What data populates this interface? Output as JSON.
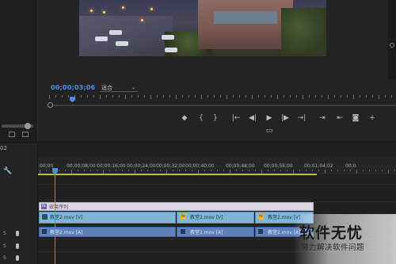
{
  "program_monitor": {
    "timecode": "00;00;03;06",
    "fit_value": "适合",
    "fit_arrow": "⌄",
    "transport": {
      "add_marker": "◆",
      "mark_in": "{",
      "mark_out": "}",
      "go_to_in": "|←",
      "step_back": "◀|",
      "play": "▶",
      "step_forward": "|▶",
      "go_to_out": "→|",
      "insert": "⇥",
      "overwrite": "⇤",
      "export_frame": "◙",
      "settings": "+",
      "comparison_view": "▭"
    }
  },
  "timeline": {
    "sequence_number": "02",
    "wrench": "🔧",
    "ruler_labels": [
      ":00;00",
      "00;00;08;00",
      "00;00;16;00",
      "00;00;24;00",
      "00;00;32;00",
      "00;00;40;00",
      "00;00;48;00",
      "00;00;56;00",
      "00;01;04;02",
      "00;0"
    ],
    "nested_sequence": {
      "label": "嵌套序列",
      "fx": "fx"
    },
    "video_clips": [
      {
        "label": "教堂2.mov [V]",
        "fx": ""
      },
      {
        "label": "教堂2.mov [V]",
        "fx": "fx"
      },
      {
        "label": "教堂2.mov [V]",
        "fx": "fx"
      }
    ],
    "audio_clips": [
      {
        "label": "教堂2.mov [A]"
      },
      {
        "label": "教堂2.mov [A]"
      },
      {
        "label": "教堂2.mov [A]"
      }
    ],
    "audio_track_letters": [
      "S",
      "S",
      "S"
    ]
  },
  "watermark": {
    "logo": "软件无忧",
    "tagline": "努力解决软件问题"
  },
  "colors": {
    "accent_blue": "#4a90e2",
    "work_area": "#b9bd2e",
    "video_clip": "#7fb5d6",
    "audio_clip": "#5f7fb8",
    "nested_clip": "#d9d6e6"
  }
}
